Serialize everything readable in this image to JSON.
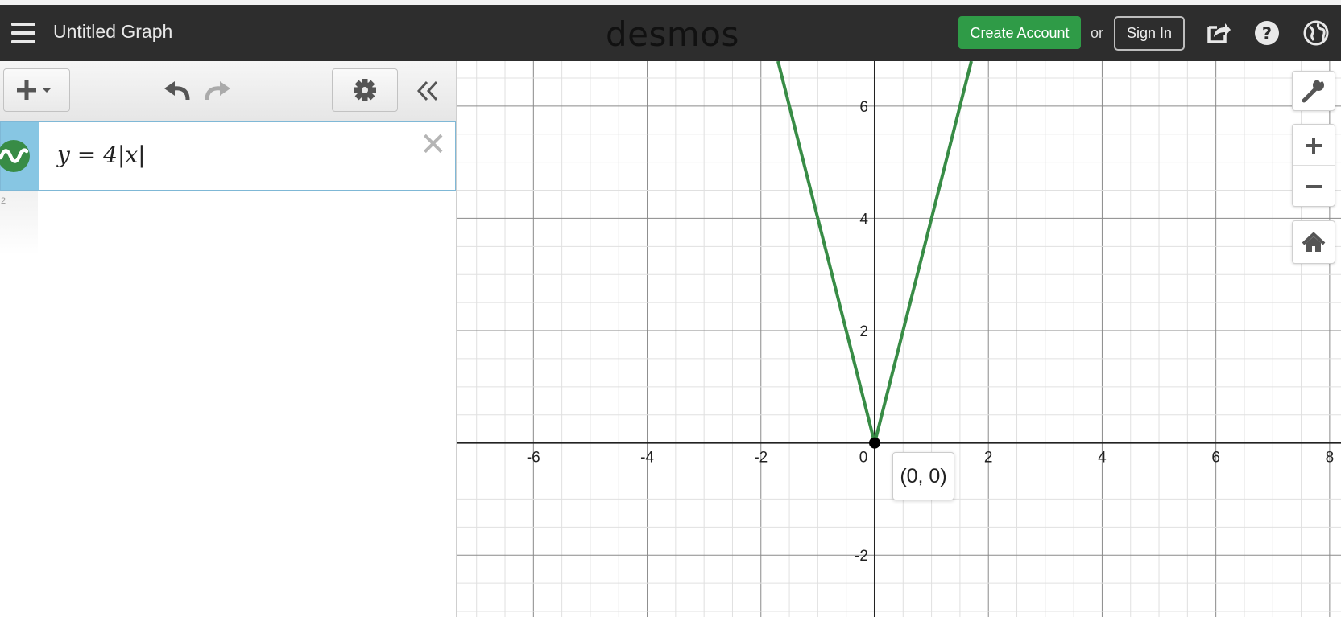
{
  "header": {
    "title": "Untitled Graph",
    "logo": "desmos",
    "create_account": "Create Account",
    "or": "or",
    "sign_in": "Sign In",
    "icons": [
      "menu-icon",
      "share-icon",
      "help-icon",
      "globe-icon"
    ]
  },
  "expressions": {
    "toolbar_icons": [
      "add-icon",
      "undo-icon",
      "redo-icon",
      "gear-icon",
      "collapse-icon"
    ],
    "items": [
      {
        "index": "1",
        "latex": "y = 4|x|",
        "color": "#388c46"
      }
    ],
    "next_index": "2"
  },
  "graph": {
    "x_ticks": [
      "-6",
      "-4",
      "-2",
      "0",
      "2",
      "4",
      "6",
      "8"
    ],
    "y_ticks": [
      "6",
      "4",
      "2",
      "-2"
    ],
    "point_label": "(0, 0)",
    "curve_color": "#388c46",
    "tools": [
      "wrench-icon",
      "zoom-in-icon",
      "zoom-out-icon",
      "home-icon"
    ]
  },
  "chart_data": {
    "type": "line",
    "function": "y=4|x|",
    "x_range": [
      -7.35,
      8.2
    ],
    "y_range": [
      -3.1,
      6.8
    ],
    "series": [
      {
        "x": [
          -1.7,
          0,
          1.7
        ],
        "y": [
          6.8,
          0,
          6.8
        ]
      }
    ],
    "points": [
      {
        "x": 0,
        "y": 0
      }
    ],
    "grid": true,
    "minor_grid": true
  },
  "colors": {
    "header_bg": "#2d2d2d",
    "create_account_bg": "#2f9b47",
    "expression_tab": "#87c6e3"
  }
}
